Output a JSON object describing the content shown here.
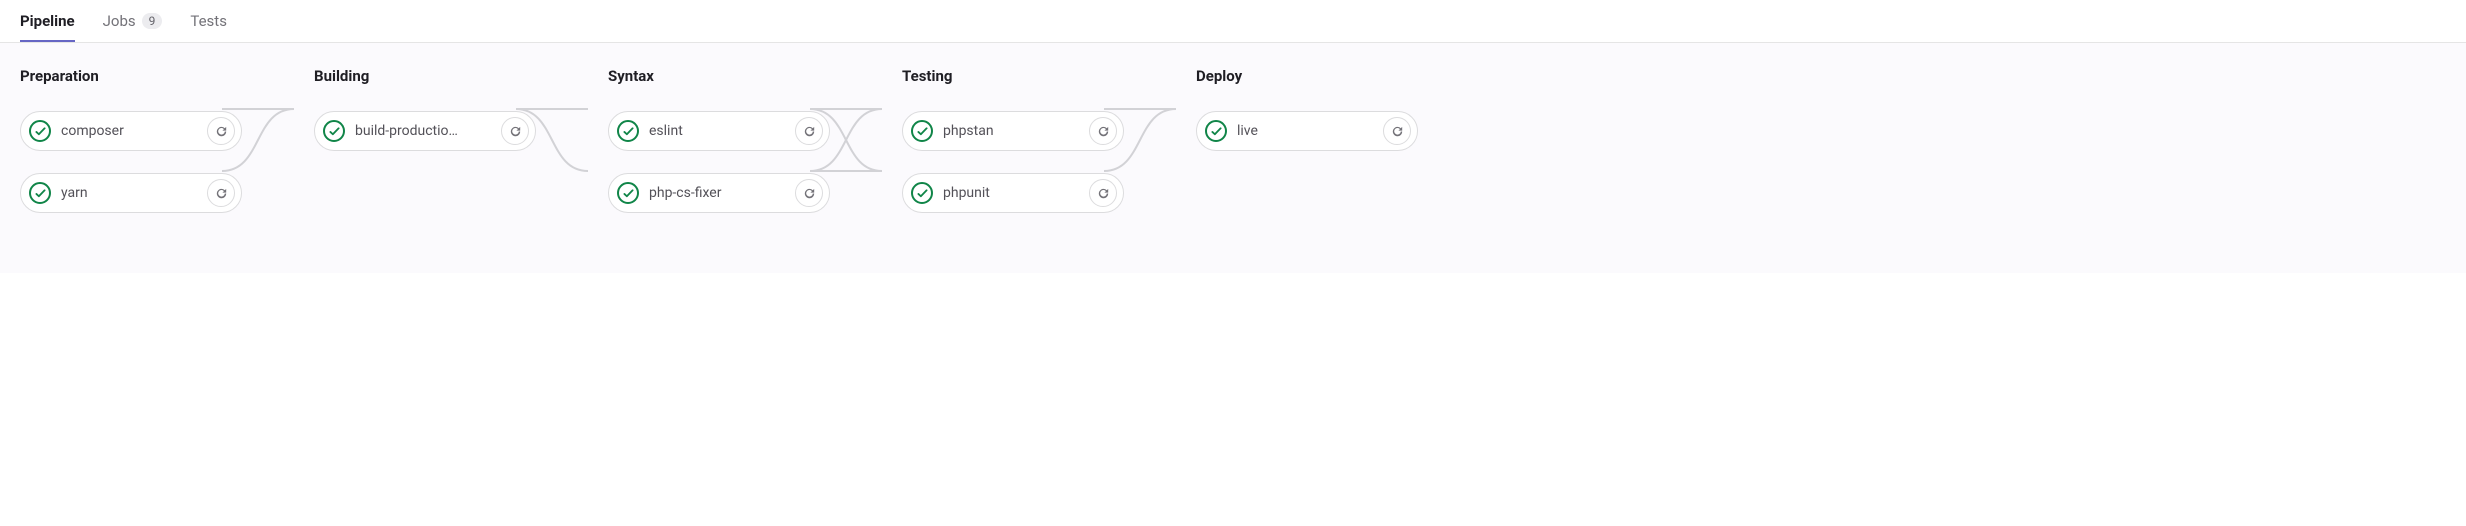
{
  "tabs": [
    {
      "label": "Pipeline",
      "active": true
    },
    {
      "label": "Jobs",
      "badge": "9",
      "active": false
    },
    {
      "label": "Tests",
      "active": false
    }
  ],
  "stages": [
    {
      "title": "Preparation",
      "jobs": [
        {
          "name": "composer",
          "status": "passed"
        },
        {
          "name": "yarn",
          "status": "passed"
        }
      ]
    },
    {
      "title": "Building",
      "jobs": [
        {
          "name": "build-productio…",
          "status": "passed"
        }
      ]
    },
    {
      "title": "Syntax",
      "jobs": [
        {
          "name": "eslint",
          "status": "passed"
        },
        {
          "name": "php-cs-fixer",
          "status": "passed"
        }
      ]
    },
    {
      "title": "Testing",
      "jobs": [
        {
          "name": "phpstan",
          "status": "passed"
        },
        {
          "name": "phpunit",
          "status": "passed"
        }
      ]
    },
    {
      "title": "Deploy",
      "jobs": [
        {
          "name": "live",
          "status": "passed"
        }
      ]
    }
  ],
  "colors": {
    "success": "#108548",
    "tab_active_border": "#6666c4",
    "icon_gray": "#737278"
  }
}
